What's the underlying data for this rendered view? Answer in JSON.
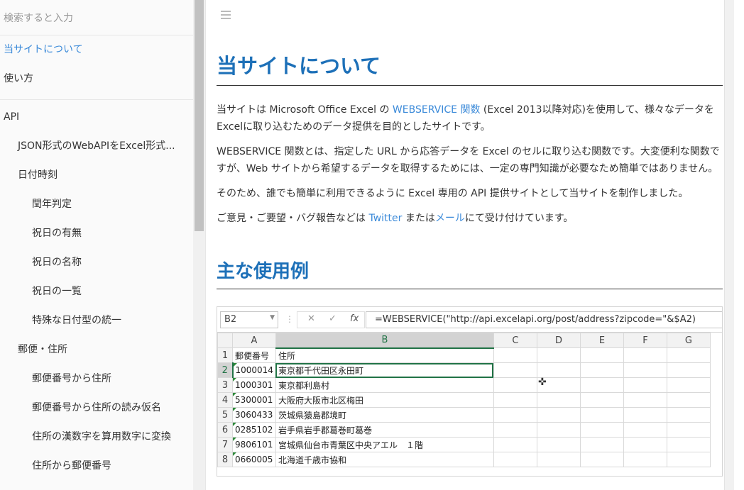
{
  "sidebar": {
    "search_placeholder": "検索すると入力",
    "items": [
      {
        "label": "当サイトについて"
      },
      {
        "label": "使い方"
      },
      {
        "label": "API"
      },
      {
        "label": "JSON形式のWebAPIをExcel形式..."
      },
      {
        "label": "日付時刻"
      },
      {
        "label": "閏年判定"
      },
      {
        "label": "祝日の有無"
      },
      {
        "label": "祝日の名称"
      },
      {
        "label": "祝日の一覧"
      },
      {
        "label": "特殊な日付型の統一"
      },
      {
        "label": "郵便・住所"
      },
      {
        "label": "郵便番号から住所"
      },
      {
        "label": "郵便番号から住所の読み仮名"
      },
      {
        "label": "住所の漢数字を算用数字に変換"
      },
      {
        "label": "住所から郵便番号"
      }
    ]
  },
  "main": {
    "title": "当サイトについて",
    "p1_a": "当サイトは Microsoft Office Excel の ",
    "p1_link": "WEBSERVICE 関数",
    "p1_b": " (Excel 2013以降対応)を使用して、様々なデータをExcelに取り込むためのデータ提供を目的としたサイトです。",
    "p2": "WEBSERVICE 関数とは、指定した URL から応答データを Excel のセルに取り込む関数です。大変便利な関数ですが、Web サイトから希望するデータを取得するためには、一定の専門知識が必要なため簡単ではありません。",
    "p3": "そのため、誰でも簡単に利用できるように Excel 専用の API 提供サイトとして当サイトを制作しました。",
    "p4_a": "ご意見・ご要望・バグ報告などは ",
    "p4_link1": "Twitter",
    "p4_b": " または",
    "p4_link2": "メール",
    "p4_c": "にて受け付けています。",
    "section_title": "主な使用例"
  },
  "excel": {
    "namebox": "B2",
    "fx_cancel": "✕",
    "fx_enter": "✓",
    "fx_label": "fx",
    "formula": "=WEBSERVICE(\"http://api.excelapi.org/post/address?zipcode=\"&$A2)",
    "columns": [
      "A",
      "B",
      "C",
      "D",
      "E",
      "F",
      "G"
    ],
    "rows": [
      {
        "n": "1",
        "a": "郵便番号",
        "b": "住所"
      },
      {
        "n": "2",
        "a": "1000014",
        "b": "東京都千代田区永田町"
      },
      {
        "n": "3",
        "a": "1000301",
        "b": "東京都利島村"
      },
      {
        "n": "4",
        "a": "5300001",
        "b": "大阪府大阪市北区梅田"
      },
      {
        "n": "5",
        "a": "3060433",
        "b": "茨城県猿島郡境町"
      },
      {
        "n": "6",
        "a": "0285102",
        "b": "岩手県岩手郡葛巻町葛巻"
      },
      {
        "n": "7",
        "a": "9806101",
        "b": "宮城県仙台市青葉区中央アエル　１階"
      },
      {
        "n": "8",
        "a": "0660005",
        "b": "北海道千歳市協和"
      }
    ]
  }
}
